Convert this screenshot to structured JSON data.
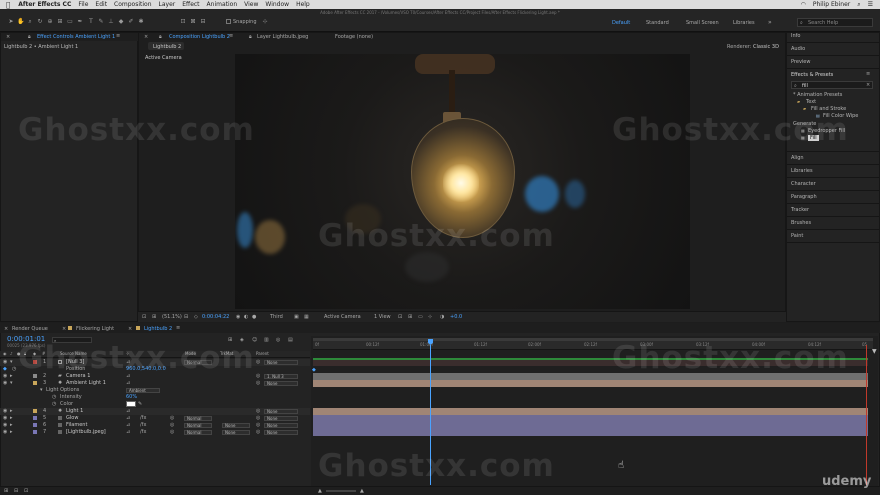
{
  "menubar": {
    "app": "After Effects CC",
    "items": [
      "File",
      "Edit",
      "Composition",
      "Layer",
      "Effect",
      "Animation",
      "View",
      "Window",
      "Help"
    ],
    "user": "Philip Ebiner"
  },
  "window": {
    "title": "Adobe After Effects CC 2017 - /Volumes/VSO T0/Courses/After Effects CC/Project Files/After Effects Flickering Light.aep *"
  },
  "toolbar": {
    "snapping_label": "Snapping",
    "workspaces": [
      "Default",
      "Standard",
      "Small Screen",
      "Libraries"
    ],
    "active_workspace": "Default",
    "search_placeholder": "Search Help"
  },
  "effect_controls": {
    "tab_label": "Effect Controls Ambient Light 1",
    "breadcrumb": "Lightbulb 2 • Ambient Light 1"
  },
  "composition": {
    "tabs": [
      "Composition Lightbulb 2",
      "Layer Lightbulb.jpeg",
      "Footage (none)"
    ],
    "sub_tab": "Lightbulb 2",
    "camera_label": "Active Camera",
    "renderer_label": "Renderer:",
    "renderer_value": "Classic 3D",
    "footer": {
      "zoom": "(51.1%)",
      "timecode": "0:00:04:22",
      "resolution": "Third",
      "camera": "Active Camera",
      "view": "1 View",
      "exposure": "+0.0"
    }
  },
  "right_panel": {
    "info": "Info",
    "audio": "Audio",
    "preview": "Preview",
    "effects_title": "Effects & Presets",
    "search_value": "fill",
    "tree": [
      "* Animation Presets",
      "Text",
      "Fill and Stroke",
      "Fill Color Wipe",
      "Generate",
      "Eyedropper Fill",
      "Fill"
    ],
    "collapsed": [
      "Align",
      "Libraries",
      "Character",
      "Paragraph",
      "Tracker",
      "Brushes",
      "Paint"
    ]
  },
  "timeline": {
    "tabs": [
      "Render Queue",
      "Flickering Light",
      "Lightbulb 2"
    ],
    "active_tab": "Lightbulb 2",
    "timecode": "0:00:01:01",
    "frame_info": "00025 (23.976 fps)",
    "column_headers": {
      "source_name": "Source Name",
      "mode": "Mode",
      "trkmat": "TrkMat",
      "parent": "Parent"
    },
    "layers": [
      {
        "num": "1",
        "name": "[Null 3]",
        "mode": "Normal",
        "trkmat": "",
        "parent": "None",
        "color": "#b3473e"
      },
      {
        "num": "",
        "name": "Position",
        "mode": "",
        "trkmat": "",
        "parent": "",
        "color": ""
      },
      {
        "num": "2",
        "name": "Camera 1",
        "mode": "",
        "trkmat": "",
        "parent": "1. Null 3",
        "color": "#8a8a8a"
      },
      {
        "num": "3",
        "name": "Ambient Light 1",
        "mode": "",
        "trkmat": "",
        "parent": "None",
        "color": "#c9a65a"
      },
      {
        "num": "",
        "name": "Light Options",
        "mode": "Ambient",
        "trkmat": "",
        "parent": "",
        "color": ""
      },
      {
        "num": "",
        "name": "Intensity",
        "mode": "",
        "trkmat": "",
        "parent": "",
        "color": ""
      },
      {
        "num": "",
        "name": "Color",
        "mode": "",
        "trkmat": "",
        "parent": "",
        "color": ""
      },
      {
        "num": "4",
        "name": "Light 1",
        "mode": "",
        "trkmat": "",
        "parent": "None",
        "color": "#c9a65a"
      },
      {
        "num": "5",
        "name": "Glow",
        "mode": "Normal",
        "trkmat": "",
        "parent": "None",
        "color": "#7a77b5"
      },
      {
        "num": "6",
        "name": "Filament",
        "mode": "Normal",
        "trkmat": "None",
        "parent": "None",
        "color": "#7a77b5"
      },
      {
        "num": "7",
        "name": "[Lightbulb.jpeg]",
        "mode": "Normal",
        "trkmat": "None",
        "parent": "None",
        "color": "#7a77b5"
      }
    ],
    "position_value": "960.0,540.0,0.0",
    "intensity_value": "60%",
    "ruler": [
      "00:12f",
      "01:00f",
      "01:12f",
      "02:00f",
      "02:12f",
      "03:00f",
      "03:12f",
      "04:00f",
      "04:12f"
    ],
    "ruler_start": "0f",
    "ruler_end": "05"
  },
  "watermark": "Ghostxx.com",
  "udemy": "udemy",
  "colors": {
    "accent": "#4aa3ff",
    "panel_bg": "#232323",
    "track_tan": "#a08575",
    "track_purple": "#6e6b94",
    "playhead": "#4aa3ff",
    "end_marker": "#c0392b"
  }
}
